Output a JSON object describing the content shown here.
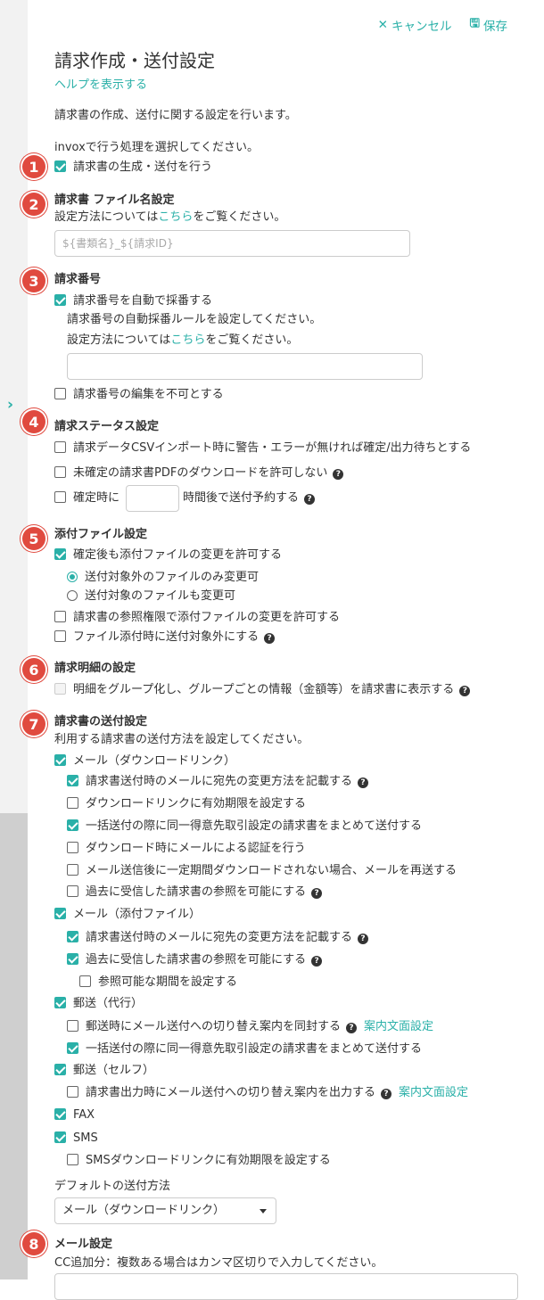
{
  "header": {
    "cancel_label": "キャンセル",
    "save_label": "保存"
  },
  "page": {
    "title": "請求作成・送付設定",
    "help_link": "ヘルプを表示する",
    "description": "請求書の作成、送付に関する設定を行います。"
  },
  "s1": {
    "num": "1",
    "prompt": "invoxで行う処理を選択してください。",
    "generate_label": "請求書の生成・送付を行う"
  },
  "s2": {
    "num": "2",
    "heading": "請求書 ファイル名設定",
    "desc_pre": "設定方法については",
    "desc_link": "こちら",
    "desc_post": "をご覧ください。",
    "placeholder": "${書類名}_${請求ID}"
  },
  "s3": {
    "num": "3",
    "heading": "請求番号",
    "auto_label": "請求番号を自動で採番する",
    "rule_text": "請求番号の自動採番ルールを設定してください。",
    "desc_pre": "設定方法については",
    "desc_link": "こちら",
    "desc_post": "をご覧ください。",
    "no_edit_label": "請求番号の編集を不可とする"
  },
  "s4": {
    "num": "4",
    "heading": "請求ステータス設定",
    "csv_label": "請求データCSVインポート時に警告・エラーが無ければ確定/出力待ちとする",
    "pdf_label": "未確定の請求書PDFのダウンロードを許可しない",
    "confirm_pre": "確定時に",
    "confirm_post": "時間後で送付予約する"
  },
  "s5": {
    "num": "5",
    "heading": "添付ファイル設定",
    "allow_change_label": "確定後も添付ファイルの変更を許可する",
    "radio_outside": "送付対象外のファイルのみ変更可",
    "radio_target": "送付対象のファイルも変更可",
    "ref_perm_label": "請求書の参照権限で添付ファイルの変更を許可する",
    "exclude_label": "ファイル添付時に送付対象外にする"
  },
  "s6": {
    "num": "6",
    "heading": "請求明細の設定",
    "group_label": "明細をグループ化し、グループごとの情報（金額等）を請求書に表示する"
  },
  "s7": {
    "num": "7",
    "heading": "請求書の送付設定",
    "desc": "利用する請求書の送付方法を設定してください。",
    "mail_dl": "メール（ダウンロードリンク）",
    "mail_dl_opt1": "請求書送付時のメールに宛先の変更方法を記載する",
    "mail_dl_opt2": "ダウンロードリンクに有効期限を設定する",
    "mail_dl_opt3": "一括送付の際に同一得意先取引設定の請求書をまとめて送付する",
    "mail_dl_opt4": "ダウンロード時にメールによる認証を行う",
    "mail_dl_opt5": "メール送信後に一定期間ダウンロードされない場合、メールを再送する",
    "mail_dl_opt6": "過去に受信した請求書の参照を可能にする",
    "mail_att": "メール（添付ファイル）",
    "mail_att_opt1": "請求書送付時のメールに宛先の変更方法を記載する",
    "mail_att_opt2": "過去に受信した請求書の参照を可能にする",
    "mail_att_opt3": "参照可能な期間を設定する",
    "post_agent": "郵送（代行）",
    "post_agent_opt1": "郵送時にメール送付への切り替え案内を同封する",
    "post_agent_link": "案内文面設定",
    "post_agent_opt2": "一括送付の際に同一得意先取引設定の請求書をまとめて送付する",
    "post_self": "郵送（セルフ）",
    "post_self_opt1": "請求書出力時にメール送付への切り替え案内を出力する",
    "post_self_link": "案内文面設定",
    "fax": "FAX",
    "sms": "SMS",
    "sms_opt1": "SMSダウンロードリンクに有効期限を設定する",
    "default_label": "デフォルトの送付方法",
    "default_value": "メール（ダウンロードリンク）"
  },
  "s8": {
    "num": "8",
    "heading": "メール設定",
    "cc_desc": "CC追加分：複数ある場合はカンマ区切りで入力してください。"
  },
  "colors": {
    "accent": "#2ab0a8",
    "badge": "#e04a3f"
  }
}
